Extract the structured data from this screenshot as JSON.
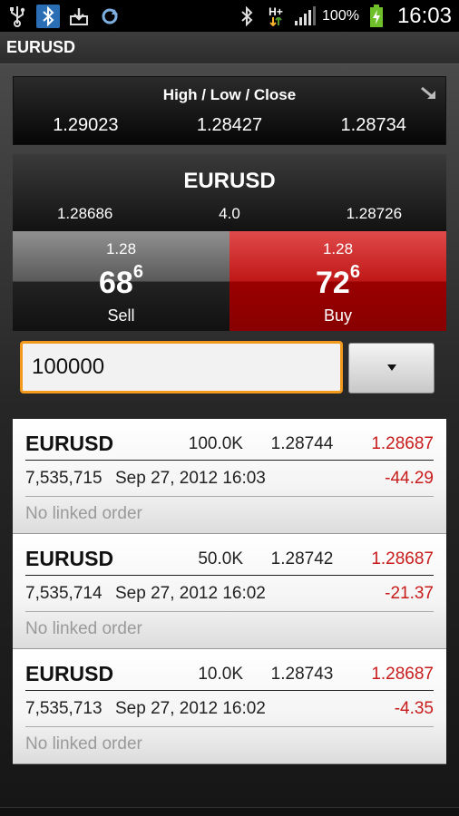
{
  "status_bar": {
    "icons_left": [
      "usb-icon",
      "bluetooth-icon",
      "download-icon",
      "sync-icon"
    ],
    "icons_right": [
      "bluetooth-icon",
      "hplus-data-icon",
      "signal-icon",
      "battery-charging-icon"
    ],
    "network_label": "H+",
    "battery_percent": "100%",
    "time": "16:03"
  },
  "title_bar": {
    "title": "EURUSD"
  },
  "hlc": {
    "title": "High / Low / Close",
    "high": "1.29023",
    "low": "1.28427",
    "close": "1.28734"
  },
  "quote": {
    "symbol": "EURUSD",
    "bid": "1.28686",
    "spread": "4.0",
    "ask": "1.28726"
  },
  "sell": {
    "prefix": "1.28",
    "pips": "68",
    "pipette": "6",
    "label": "Sell"
  },
  "buy": {
    "prefix": "1.28",
    "pips": "72",
    "pipette": "6",
    "label": "Buy"
  },
  "amount": {
    "value": "100000"
  },
  "positions": [
    {
      "symbol": "EURUSD",
      "amount": "100.0K",
      "open_price": "1.28744",
      "current_price": "1.28687",
      "ticket": "7,535,715",
      "time": "Sep 27, 2012 16:03",
      "pl": "-44.29",
      "linked": "No linked order"
    },
    {
      "symbol": "EURUSD",
      "amount": "50.0K",
      "open_price": "1.28742",
      "current_price": "1.28687",
      "ticket": "7,535,714",
      "time": "Sep 27, 2012 16:02",
      "pl": "-21.37",
      "linked": "No linked order"
    },
    {
      "symbol": "EURUSD",
      "amount": "10.0K",
      "open_price": "1.28743",
      "current_price": "1.28687",
      "ticket": "7,535,713",
      "time": "Sep 27, 2012 16:02",
      "pl": "-4.35",
      "linked": "No linked order"
    }
  ],
  "colors": {
    "buy": "#c01818",
    "negative": "#c81b1b",
    "input_focus": "#f39a1d",
    "bluetooth_active": "#2a6fb5"
  }
}
